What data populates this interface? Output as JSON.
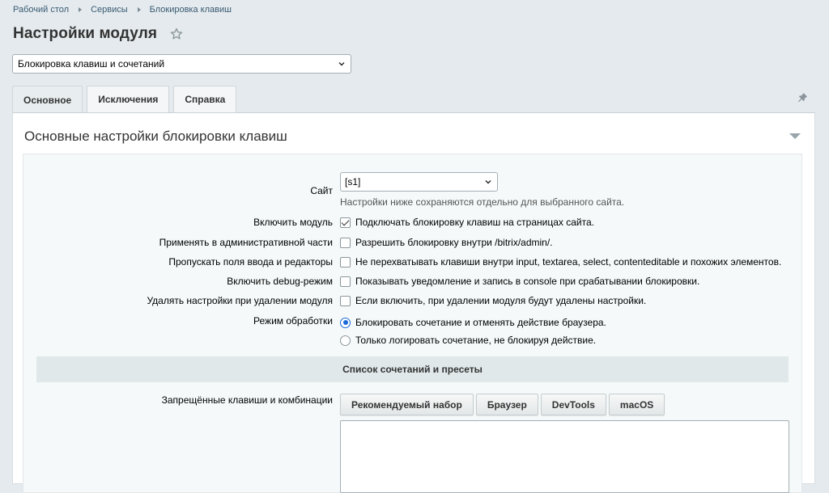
{
  "breadcrumb": [
    "Рабочий стол",
    "Сервисы",
    "Блокировка клавиш"
  ],
  "page_title": "Настройки модуля",
  "module_select": {
    "value": "Блокировка клавиш и сочетаний"
  },
  "tabs": [
    {
      "label": "Основное",
      "active": true
    },
    {
      "label": "Исключения",
      "active": false
    },
    {
      "label": "Справка",
      "active": false
    }
  ],
  "section": {
    "title": "Основные настройки блокировки клавиш",
    "site": {
      "label": "Сайт",
      "value": "[s1]",
      "hint": "Настройки ниже сохраняются отдельно для выбранного сайта."
    },
    "options": [
      {
        "label": "Включить модуль",
        "text": "Подключать блокировку клавиш на страницах сайта.",
        "checked": true
      },
      {
        "label": "Применять в административной части",
        "text": "Разрешить блокировку внутри /bitrix/admin/.",
        "checked": false
      },
      {
        "label": "Пропускать поля ввода и редакторы",
        "text": "Не перехватывать клавиши внутри input, textarea, select, contenteditable и похожих элементов.",
        "checked": false
      },
      {
        "label": "Включить debug-режим",
        "text": "Показывать уведомление и запись в console при срабатывании блокировки.",
        "checked": false
      },
      {
        "label": "Удалять настройки при удалении модуля",
        "text": "Если включить, при удалении модуля будут удалены настройки.",
        "checked": false
      }
    ],
    "mode": {
      "label": "Режим обработки",
      "options": [
        {
          "text": "Блокировать сочетание и отменять действие браузера.",
          "checked": true
        },
        {
          "text": "Только логировать сочетание, не блокируя действие.",
          "checked": false
        }
      ]
    },
    "subheader": "Список сочетаний и пресеты",
    "keys": {
      "label": "Запрещённые клавиши и комбинации",
      "presets": [
        "Рекомендуемый набор",
        "Браузер",
        "DevTools",
        "macOS"
      ],
      "value": ""
    }
  },
  "colors": {
    "background": "#e4eaed",
    "accent": "#1b6ad9"
  }
}
